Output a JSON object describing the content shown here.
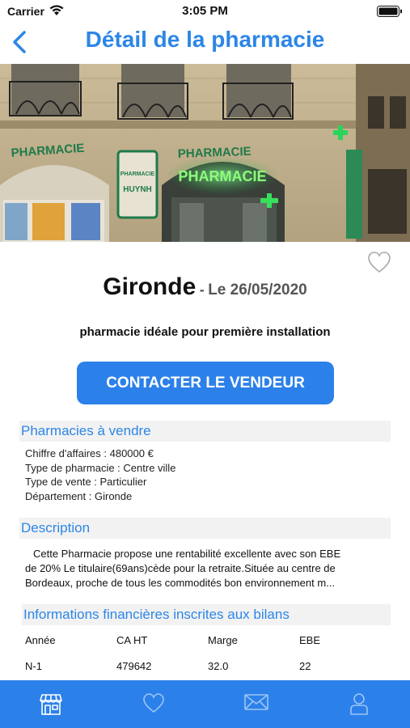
{
  "status_bar": {
    "carrier": "Carrier",
    "time": "3:05 PM"
  },
  "nav": {
    "title": "Détail de la pharmacie"
  },
  "listing": {
    "title": "Gironde",
    "separator": "-",
    "date": "Le 26/05/2020",
    "subtitle": "pharmacie idéale pour première installation",
    "contact_label": "CONTACTER LE VENDEUR"
  },
  "hero_signs": {
    "pharmacie_left": "PHARMACIE",
    "pharmacie_center": "PHARMACIE",
    "neon": "PHARMACIE",
    "plaque_top": "PHARMACIE",
    "plaque_name": "HUYNH"
  },
  "sections": {
    "for_sale": {
      "header": "Pharmacies à vendre",
      "lines": [
        "Chiffre d'affaires : 480000 €",
        "Type de pharmacie : Centre ville",
        "Type de vente : Particulier",
        "Département : Gironde"
      ]
    },
    "description": {
      "header": "Description",
      "lines": [
        "Cette Pharmacie propose une rentabilité excellente avec son EBE",
        "de 20% Le titulaire(69ans)cède pour la retraite.Située au centre de",
        "Bordeaux, proche de tous les commodités bon environnement m..."
      ]
    },
    "financials": {
      "header": "Informations financières inscrites aux bilans",
      "columns": [
        "Année",
        "CA HT",
        "Marge",
        "EBE"
      ],
      "rows": [
        [
          "N-1",
          "479642",
          "32.0",
          "22"
        ]
      ]
    }
  },
  "tabs": [
    {
      "icon": "storefront-icon",
      "active": true
    },
    {
      "icon": "heart-icon",
      "active": false
    },
    {
      "icon": "mail-icon",
      "active": false
    },
    {
      "icon": "user-icon",
      "active": false
    }
  ],
  "colors": {
    "accent": "#2c86e6",
    "button": "#2c80ea",
    "section_bg": "#f2f2f2"
  }
}
